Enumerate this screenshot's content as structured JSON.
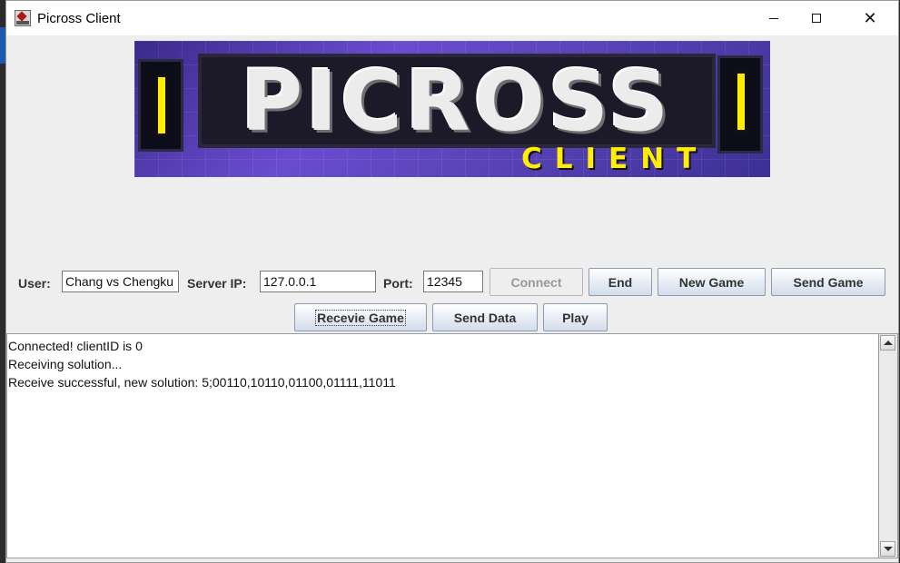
{
  "window": {
    "title": "Picross Client"
  },
  "banner": {
    "title": "PICROSS",
    "subtitle": "CLIENT"
  },
  "form": {
    "user_label": "User:",
    "user_value": "Chang vs Chengku",
    "server_ip_label": "Server IP:",
    "server_ip_value": "127.0.0.1",
    "port_label": "Port:",
    "port_value": "12345"
  },
  "buttons": {
    "connect": "Connect",
    "end": "End",
    "new_game": "New Game",
    "send_game": "Send Game",
    "receive_game": "Recevie Game",
    "send_data": "Send Data",
    "play": "Play"
  },
  "log": {
    "lines": [
      "Connected! clientID is 0",
      "Receiving solution...",
      "Receive successful, new solution: 5;00110,10110,01100,01111,11011"
    ]
  },
  "colors": {
    "window_bg": "#eeeeee",
    "banner_accent": "#ffee00",
    "banner_purple": "#6a4cd0"
  },
  "icons": {
    "app": "java-cup-icon",
    "minimize": "minimize-icon",
    "maximize": "maximize-icon",
    "close": "close-icon",
    "scroll_up": "arrow-up-icon",
    "scroll_down": "arrow-down-icon"
  }
}
